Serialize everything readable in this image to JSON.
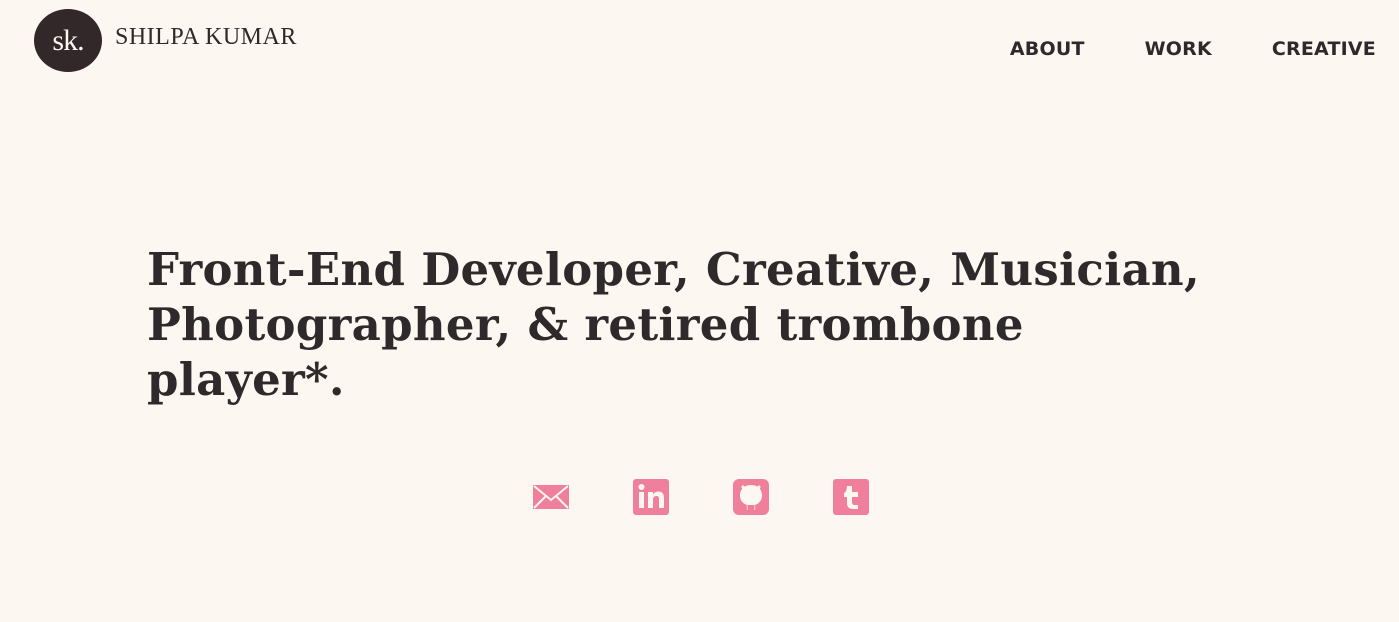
{
  "header": {
    "logo_mark": "sk.",
    "logo_name": "SHILPA KUMAR"
  },
  "nav": {
    "items": [
      {
        "label": "ABOUT"
      },
      {
        "label": "WORK"
      },
      {
        "label": "CREATIVE"
      }
    ]
  },
  "hero": {
    "headline": "Front-End Developer, Creative, Musician, Photographer, & retired trombone player*."
  },
  "social": {
    "icons": [
      "envelope-icon",
      "linkedin-icon",
      "github-icon",
      "tumblr-icon"
    ],
    "accent_color": "#ef7f9a"
  },
  "colors": {
    "background": "#fdf7f1",
    "text": "#2e2a2b",
    "logo_badge": "#332829"
  }
}
